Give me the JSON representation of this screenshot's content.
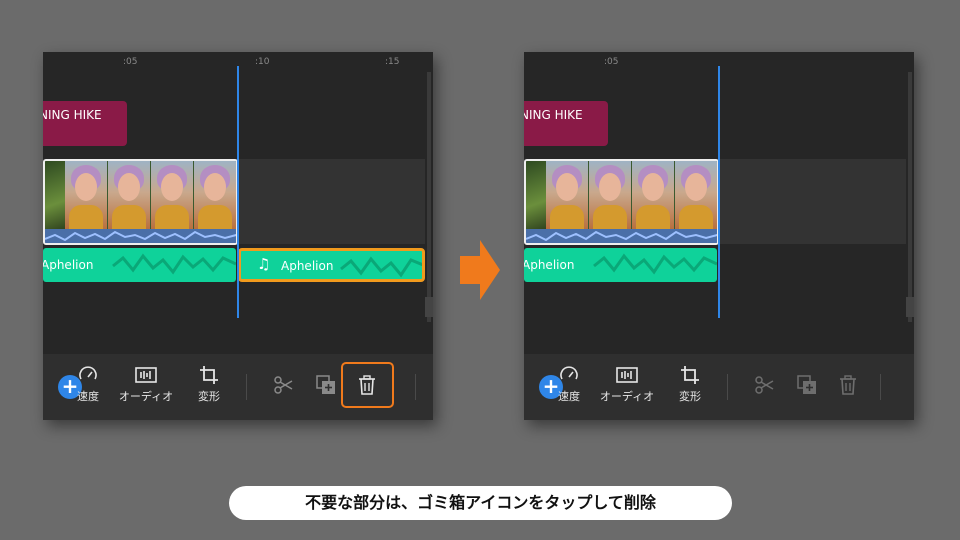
{
  "ruler_ticks": [
    ":05",
    ":10",
    ":15"
  ],
  "title_clip": {
    "text": "NING HIKE",
    "color": "#8a1a47"
  },
  "music_clip": {
    "name": "Aphelion",
    "color": "#0fd29a",
    "note_icon": "music-note-icon"
  },
  "toolbar": {
    "add_icon": "+",
    "speed_label": "速度",
    "audio_label": "オーディオ",
    "transform_label": "変形",
    "icons": [
      "speed-icon",
      "audio-waveform-icon",
      "crop-icon",
      "scissors-icon",
      "duplicate-icon",
      "trash-icon"
    ]
  },
  "colors": {
    "playhead": "#2f86e8",
    "selection": "#f19a1d",
    "highlight": "#f07a1c",
    "arrow": "#f07a1c"
  },
  "caption": "不要な部分は、ゴミ箱アイコンをタップして削除"
}
